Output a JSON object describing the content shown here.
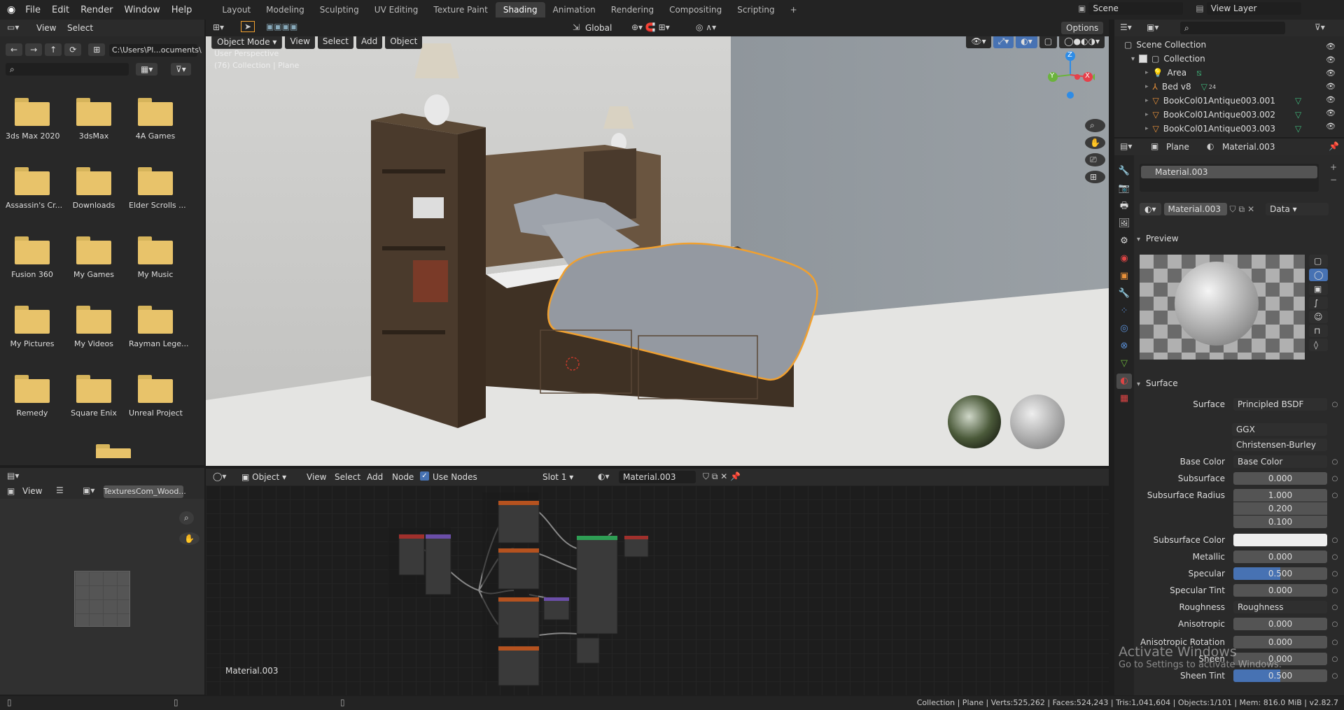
{
  "topbar": {
    "menus": [
      "File",
      "Edit",
      "Render",
      "Window",
      "Help"
    ],
    "workspaces": [
      "Layout",
      "Modeling",
      "Sculpting",
      "UV Editing",
      "Texture Paint",
      "Shading",
      "Animation",
      "Rendering",
      "Compositing",
      "Scripting"
    ],
    "active_workspace": "Shading",
    "add_tab": "+",
    "scene": "Scene",
    "view_layer": "View Layer"
  },
  "file_browser": {
    "menus": [
      "View",
      "Select"
    ],
    "path": "C:\\Users\\Pl...ocuments\\",
    "folders": [
      "3ds Max 2020",
      "3dsMax",
      "4A Games",
      "Assassin's Cr...",
      "Downloads",
      "Elder Scrolls ...",
      "Fusion 360",
      "My Games",
      "My Music",
      "My Pictures",
      "My Videos",
      "Rayman Lege...",
      "Remedy",
      "Square Enix",
      "Unreal Project"
    ]
  },
  "image_editor": {
    "view": "View",
    "image_name": "TexturesCom_Wood..."
  },
  "viewport": {
    "mode": "Object Mode",
    "menus": [
      "View",
      "Select",
      "Add",
      "Object"
    ],
    "transform": "Global",
    "options": "Options",
    "overlay_line1": "User Perspective",
    "overlay_line2": "(76) Collection | Plane",
    "axis_x": "X",
    "axis_y": "Y",
    "axis_z": "Z"
  },
  "node_editor": {
    "type": "Object",
    "menus": [
      "View",
      "Select",
      "Add",
      "Node"
    ],
    "use_nodes": "Use Nodes",
    "slot": "Slot 1",
    "material": "Material.003",
    "label": "Material.003"
  },
  "outliner": {
    "scene_collection": "Scene Collection",
    "collection": "Collection",
    "items": [
      "Area",
      "Bed v8",
      "BookCol01Antique003.001",
      "BookCol01Antique003.002",
      "BookCol01Antique003.003"
    ],
    "bed_badge": "24"
  },
  "properties": {
    "object": "Plane",
    "material": "Material.003",
    "slot_material": "Material.003",
    "mat_field": "Material.003",
    "link": "Data",
    "preview_header": "Preview",
    "surface_header": "Surface",
    "rows": [
      {
        "label": "Surface",
        "value": "Principled BSDF"
      },
      {
        "label": "",
        "value": "GGX"
      },
      {
        "label": "",
        "value": "Christensen-Burley"
      },
      {
        "label": "Base Color",
        "value": "Base Color"
      },
      {
        "label": "Subsurface",
        "value": "0.000"
      },
      {
        "label": "Subsurface Radius",
        "value": "1.000"
      },
      {
        "label": "",
        "value": "0.200"
      },
      {
        "label": "",
        "value": "0.100"
      },
      {
        "label": "Subsurface Color",
        "value": ""
      },
      {
        "label": "Metallic",
        "value": "0.000"
      },
      {
        "label": "Specular",
        "value": "0.500"
      },
      {
        "label": "Specular Tint",
        "value": "0.000"
      },
      {
        "label": "Roughness",
        "value": "Roughness"
      },
      {
        "label": "Anisotropic",
        "value": "0.000"
      },
      {
        "label": "Anisotropic Rotation",
        "value": "0.000"
      },
      {
        "label": "Sheen",
        "value": "0.000"
      },
      {
        "label": "Sheen Tint",
        "value": "0.500"
      }
    ]
  },
  "watermark": {
    "line1": "Activate Windows",
    "line2": "Go to Settings to activate Windows."
  },
  "statusbar": {
    "text": "Collection | Plane | Verts:525,262 | Faces:524,243 | Tris:1,041,604 | Objects:1/101 | Mem: 816.0 MiB | v2.82.7"
  },
  "colors": {
    "accent": "#4772b3",
    "selection_outline": "#f0a030",
    "folder": "#e8c36a"
  }
}
